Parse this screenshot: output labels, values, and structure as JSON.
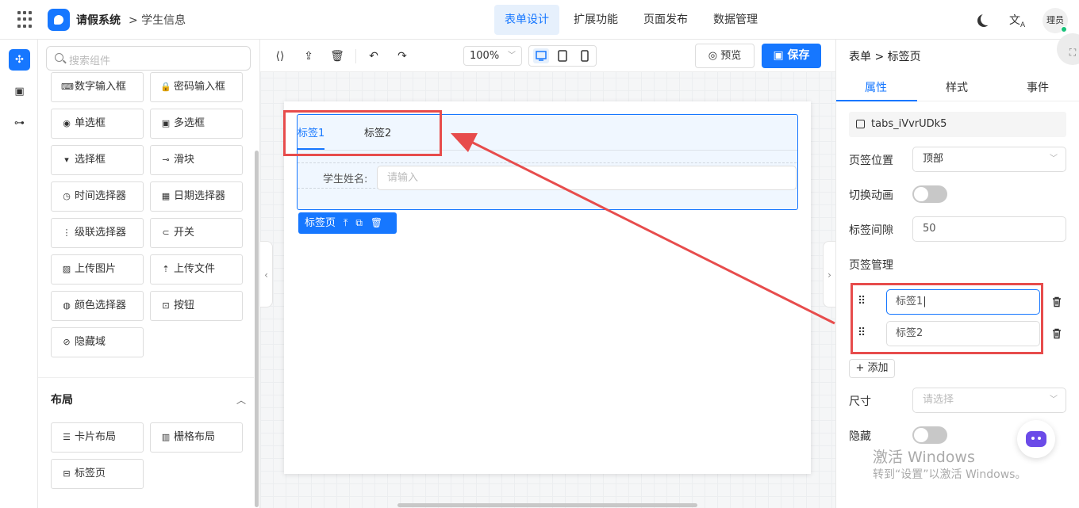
{
  "header": {
    "app_title": "请假系统",
    "breadcrumb": "> 学生信息",
    "nav": [
      "表单设计",
      "扩展功能",
      "页面发布",
      "数据管理"
    ],
    "active_nav": "表单设计",
    "avatar_text": "理员"
  },
  "components": {
    "search_placeholder": "搜索组件",
    "items": [
      {
        "label": "数字输入框",
        "icon": "number-input-icon"
      },
      {
        "label": "密码输入框",
        "icon": "lock-icon"
      },
      {
        "label": "单选框",
        "icon": "radio-icon"
      },
      {
        "label": "多选框",
        "icon": "checkbox-icon"
      },
      {
        "label": "选择框",
        "icon": "select-icon"
      },
      {
        "label": "滑块",
        "icon": "slider-icon"
      },
      {
        "label": "时间选择器",
        "icon": "clock-icon"
      },
      {
        "label": "日期选择器",
        "icon": "calendar-icon"
      },
      {
        "label": "级联选择器",
        "icon": "cascader-icon"
      },
      {
        "label": "开关",
        "icon": "switch-icon"
      },
      {
        "label": "上传图片",
        "icon": "image-icon"
      },
      {
        "label": "上传文件",
        "icon": "upload-icon"
      },
      {
        "label": "颜色选择器",
        "icon": "palette-icon"
      },
      {
        "label": "按钮",
        "icon": "button-icon"
      },
      {
        "label": "隐藏域",
        "icon": "eye-off-icon"
      }
    ],
    "layout_section": "布局",
    "layout_items": [
      {
        "label": "卡片布局",
        "icon": "card-icon"
      },
      {
        "label": "栅格布局",
        "icon": "grid-layout-icon"
      },
      {
        "label": "标签页",
        "icon": "tabs-icon"
      }
    ]
  },
  "toolbar": {
    "zoom": "100%",
    "preview": "预览",
    "save": "保存"
  },
  "canvas": {
    "tabs": [
      "标签1",
      "标签2"
    ],
    "field_label": "学生姓名:",
    "field_placeholder": "请输入",
    "selected_tag": "标签页"
  },
  "props": {
    "breadcrumb": "表单 > 标签页",
    "tabs": [
      "属性",
      "样式",
      "事件"
    ],
    "component_id": "tabs_iVvrUDk5",
    "tab_position_label": "页签位置",
    "tab_position_value": "顶部",
    "animation_label": "切换动画",
    "gap_label": "标签间隙",
    "gap_value": "50",
    "manage_label": "页签管理",
    "tab_items": [
      "标签1",
      "标签2"
    ],
    "add_label": "+ 添加",
    "size_label": "尺寸",
    "size_placeholder": "请选择",
    "hidden_label": "隐藏"
  },
  "watermark": {
    "line1": "激活 Windows",
    "line2": "转到“设置”以激活 Windows。"
  },
  "colors": {
    "primary": "#1677ff",
    "annotation_red": "#e74c4c"
  }
}
